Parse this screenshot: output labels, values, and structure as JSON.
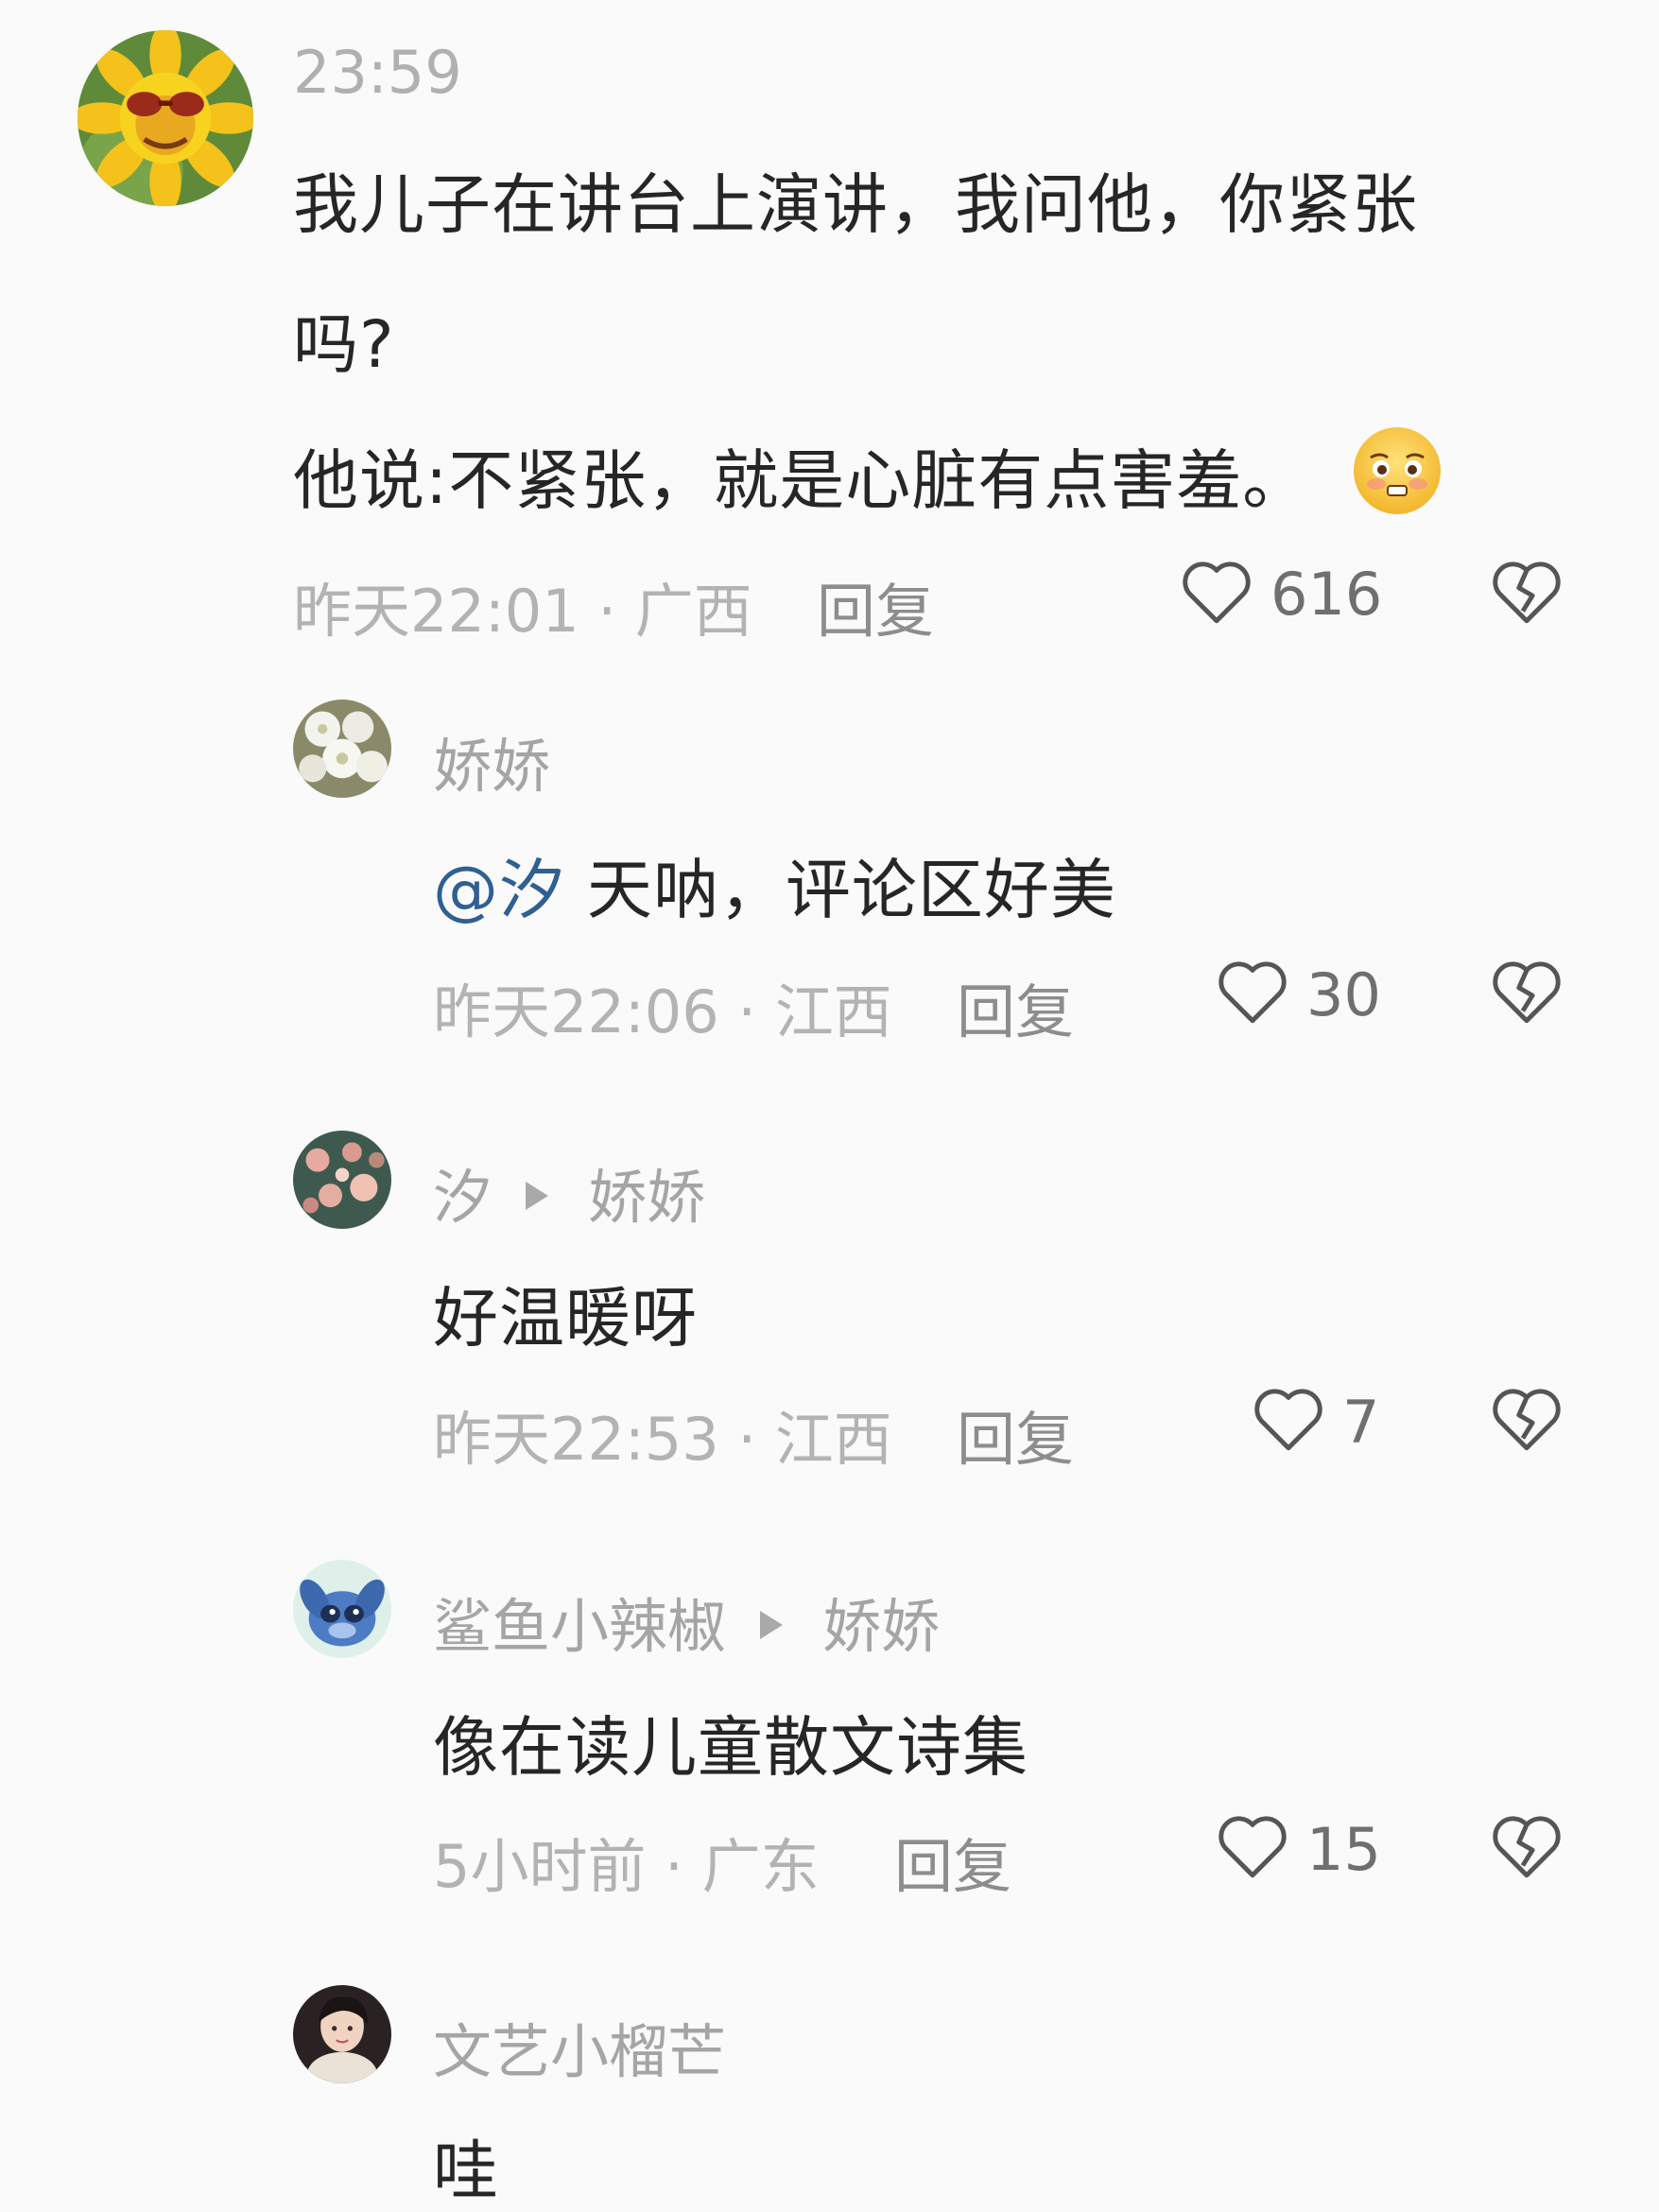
{
  "colors": {
    "background": "#fafafa",
    "text": "#262626",
    "muted": "#b3b3b3",
    "mention": "#2f5f93"
  },
  "main_comment": {
    "timestamp": "23:59",
    "text_line1": "我儿子在讲台上演讲，我问他，你紧张",
    "text_line2": "吗?",
    "text_line3": "他说:不紧张，就是心脏有点害羞。",
    "emoji": "shy-face-emoji",
    "meta": "昨天22:01 · 广西",
    "reply_label": "回复",
    "likes": "616"
  },
  "replies": [
    {
      "user": "娇娇",
      "mention": "@汐",
      "text": " 天呐，评论区好美",
      "meta": "昨天22:06 · 江西",
      "reply_label": "回复",
      "likes": "30"
    },
    {
      "user": "汐",
      "reply_to": "娇娇",
      "text": "好温暖呀",
      "meta": "昨天22:53 · 江西",
      "reply_label": "回复",
      "likes": "7"
    },
    {
      "user": "鲨鱼小辣椒",
      "reply_to": "娇娇",
      "text": "像在读儿童散文诗集",
      "meta": "5小时前 · 广东",
      "reply_label": "回复",
      "likes": "15"
    },
    {
      "user": "文艺小榴芒",
      "text": "哇"
    }
  ]
}
